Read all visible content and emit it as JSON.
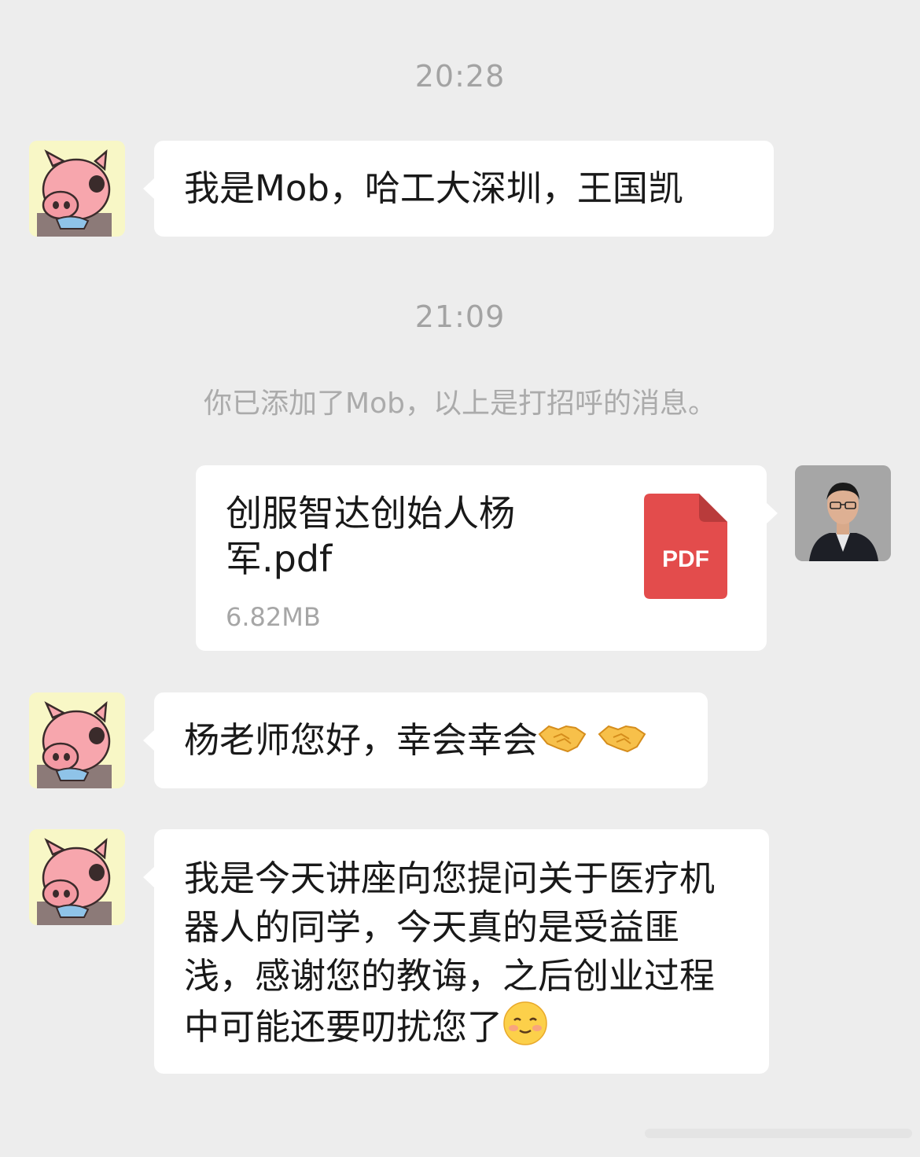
{
  "chat": {
    "timestamp1": "20:28",
    "msg1": "我是Mob，哈工大深圳，王国凯",
    "timestamp2": "21:09",
    "system_notice": "你已添加了Mob，以上是打招呼的消息。",
    "file": {
      "name": "创服智达创始人杨军.pdf",
      "size": "6.82MB",
      "icon_label": "PDF",
      "icon_color": "#e34c4c"
    },
    "msg2": "杨老师您好，幸会幸会",
    "msg2_emoji": "handshake-emoji",
    "msg3": "我是今天讲座向您提问关于医疗机器人的同学，今天真的是受益匪浅，感谢您的教诲，之后创业过程中可能还要叨扰您了",
    "msg3_emoji": "blushing-smile-emoji"
  },
  "colors": {
    "background": "#ededed",
    "bubble": "#ffffff",
    "timestamp_text": "#a3a3a3"
  }
}
